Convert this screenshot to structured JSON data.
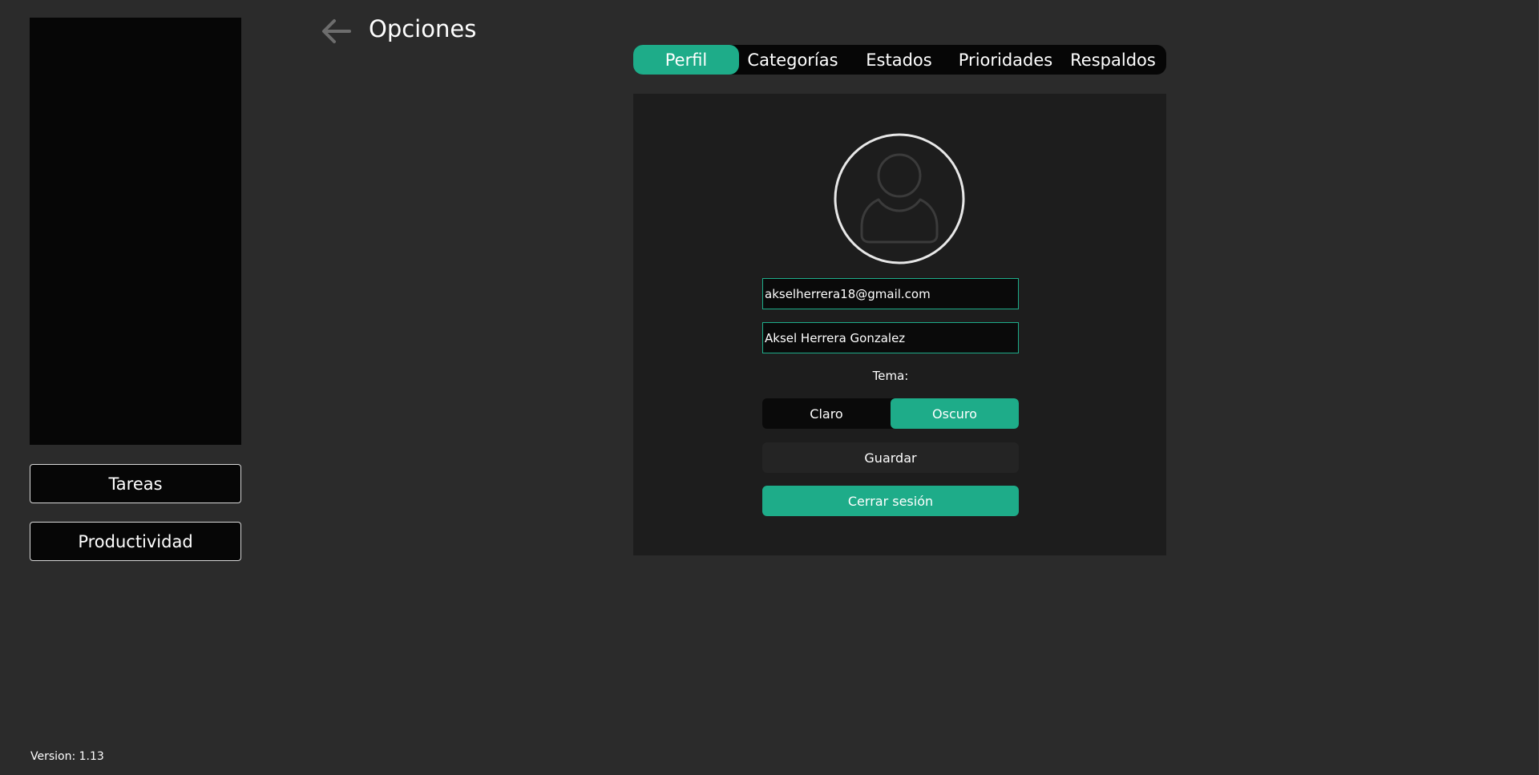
{
  "header": {
    "title": "Opciones",
    "back_icon": "arrow-left-icon"
  },
  "sidebar": {
    "nav": [
      {
        "label": "Tareas"
      },
      {
        "label": "Productividad"
      }
    ],
    "version": "Version: 1.13"
  },
  "tabs": [
    {
      "label": "Perfil",
      "active": true
    },
    {
      "label": "Categorías",
      "active": false
    },
    {
      "label": "Estados",
      "active": false
    },
    {
      "label": "Prioridades",
      "active": false
    },
    {
      "label": "Respaldos",
      "active": false
    }
  ],
  "profile": {
    "avatar_icon": "user-placeholder-icon",
    "email": "akselherrera18@gmail.com",
    "name": "Aksel Herrera Gonzalez",
    "theme_label": "Tema:",
    "theme_options": [
      {
        "label": "Claro",
        "active": false
      },
      {
        "label": "Oscuro",
        "active": true
      }
    ],
    "save_label": "Guardar",
    "logout_label": "Cerrar sesión"
  },
  "colors": {
    "accent": "#1eac89",
    "background": "#2b2b2b",
    "panel": "#060606",
    "card": "#1d1d1d"
  }
}
